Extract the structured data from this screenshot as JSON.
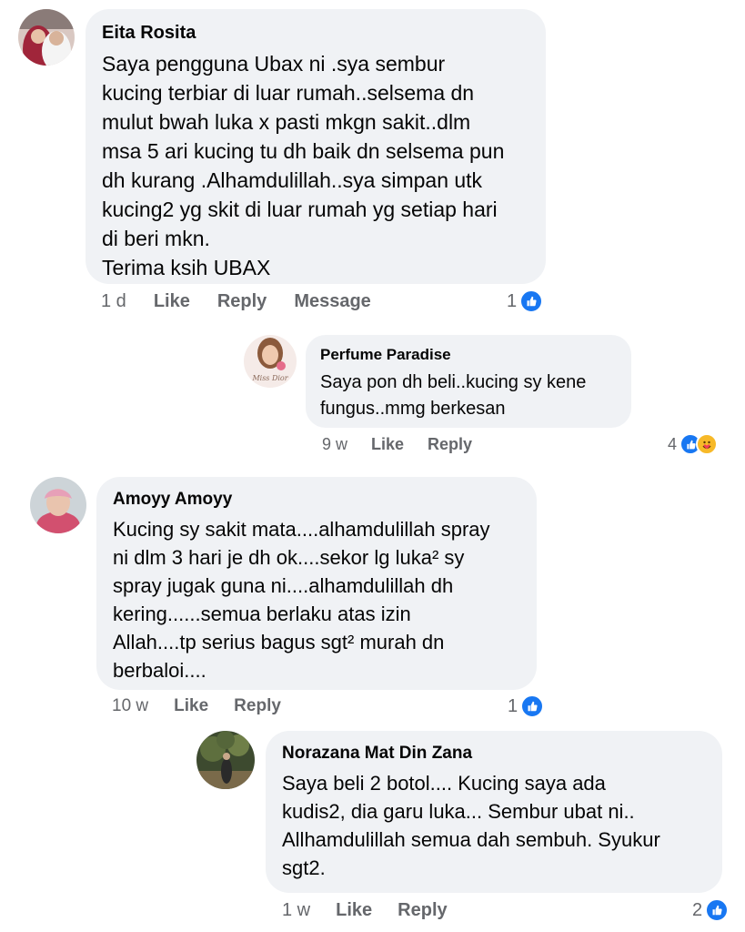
{
  "comments": [
    {
      "author": "Eita Rosita",
      "text": "Saya pengguna Ubax ni .sya sembur\nkucing terbiar di luar rumah..selsema dn\nmulut bwah luka x pasti mkgn sakit..dlm\nmsa 5 ari kucing tu dh baik dn selsema pun\ndh kurang .Alhamdulillah..sya simpan utk\nkucing2 yg skit di luar rumah yg setiap hari\ndi beri mkn.\nTerima ksih UBAX",
      "time": "1 d",
      "actions": [
        "Like",
        "Reply",
        "Message"
      ],
      "reaction_count": "1",
      "reaction_icons": [
        "like-icon"
      ]
    },
    {
      "author": "Perfume Paradise",
      "text": "Saya pon dh beli..kucing sy kene\nfungus..mmg berkesan",
      "time": "9 w",
      "actions": [
        "Like",
        "Reply"
      ],
      "reaction_count": "4",
      "reaction_icons": [
        "like-icon",
        "care-icon"
      ]
    },
    {
      "author": "Amoyy Amoyy",
      "text": "Kucing sy sakit mata....alhamdulillah spray\nni dlm 3 hari je dh ok....sekor lg luka² sy\nspray jugak guna ni....alhamdulillah dh\nkering......semua berlaku atas izin\nAllah....tp serius bagus sgt² murah dn\nberbaloi....",
      "time": "10 w",
      "actions": [
        "Like",
        "Reply"
      ],
      "reaction_count": "1",
      "reaction_icons": [
        "like-icon"
      ]
    },
    {
      "author": "Norazana Mat Din Zana",
      "text": "Saya beli 2 botol.... Kucing saya ada\nkudis2, dia garu luka... Sembur ubat ni..\nAllhamdulillah semua dah sembuh. Syukur\nsgt2.",
      "time": "1 w",
      "actions": [
        "Like",
        "Reply"
      ],
      "reaction_count": "2",
      "reaction_icons": [
        "like-icon"
      ]
    }
  ],
  "colors": {
    "bubble": "#f0f2f5",
    "meta_text": "#65676b",
    "like_blue": "#1877f2",
    "care_yellow": "#f7b928"
  }
}
